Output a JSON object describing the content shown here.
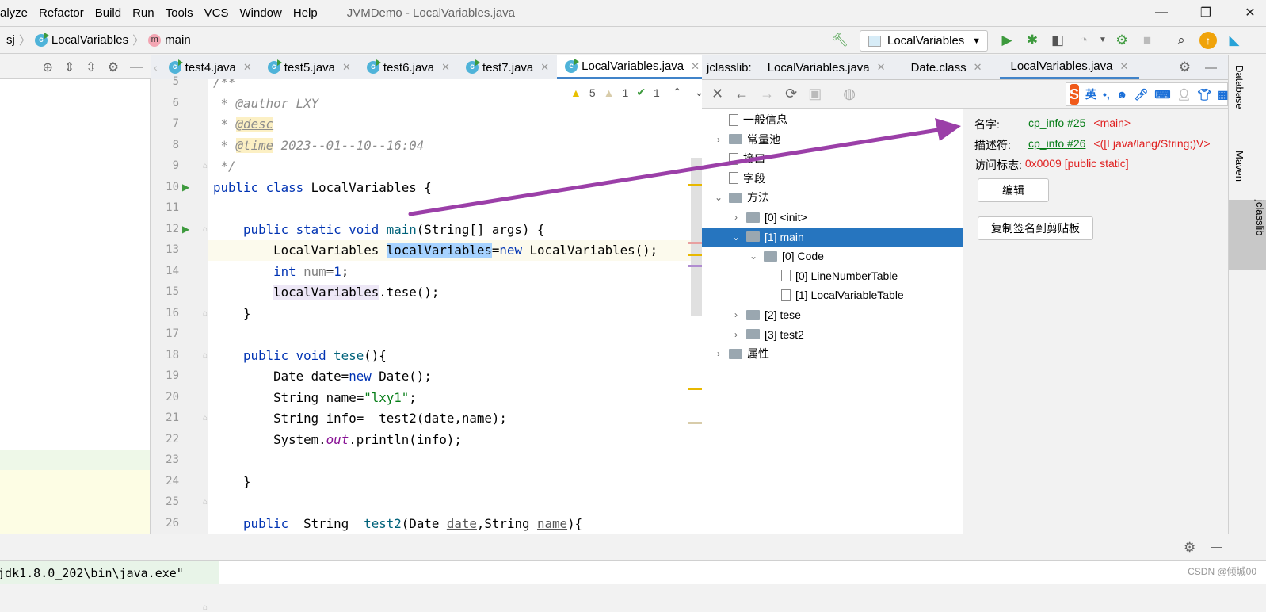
{
  "menu": {
    "items": [
      "alyze",
      "Refactor",
      "Build",
      "Run",
      "Tools",
      "VCS",
      "Window",
      "Help"
    ],
    "title": "JVMDemo - LocalVariables.java"
  },
  "breadcrumb": {
    "items": [
      "sj",
      "LocalVariables",
      "main"
    ]
  },
  "toolbar": {
    "run_config": "LocalVariables"
  },
  "editor": {
    "tabs": [
      {
        "label": "test4.java"
      },
      {
        "label": "test5.java"
      },
      {
        "label": "test6.java"
      },
      {
        "label": "test7.java"
      },
      {
        "label": "LocalVariables.java",
        "active": true
      }
    ],
    "inspections": {
      "warnings": "5",
      "weak_warnings": "1",
      "typos": "1"
    },
    "lines": [
      {
        "n": "5",
        "t": [
          [
            "/**",
            "cm"
          ]
        ]
      },
      {
        "n": "6",
        "t": [
          [
            " * ",
            "cm"
          ],
          [
            "@author",
            "tag"
          ],
          [
            " LXY",
            "cm"
          ]
        ]
      },
      {
        "n": "7",
        "t": [
          [
            " * ",
            "cm"
          ],
          [
            "@desc",
            "tagbg"
          ]
        ]
      },
      {
        "n": "8",
        "t": [
          [
            " * ",
            "cm"
          ],
          [
            "@time",
            "tagbg"
          ],
          [
            " 2023--01--10--16:04",
            "cm"
          ]
        ]
      },
      {
        "n": "9",
        "t": [
          [
            " */",
            "cm"
          ]
        ]
      },
      {
        "n": "10",
        "run": true,
        "t": [
          [
            "public class ",
            "kw"
          ],
          [
            "LocalVariables {",
            ""
          ]
        ]
      },
      {
        "n": "11",
        "t": []
      },
      {
        "n": "12",
        "run": true,
        "t": [
          [
            "    public static void ",
            "kw"
          ],
          [
            "main",
            "fn"
          ],
          [
            "(String[] args) {",
            ""
          ]
        ]
      },
      {
        "n": "13",
        "current": true,
        "t": [
          [
            "        LocalVariables ",
            ""
          ],
          [
            "localVariables",
            "sel"
          ],
          [
            "=",
            ""
          ],
          [
            "new ",
            "kw"
          ],
          [
            "LocalVariables();",
            ""
          ]
        ]
      },
      {
        "n": "14",
        "t": [
          [
            "        ",
            ""
          ],
          [
            "int ",
            "kw"
          ],
          [
            "num",
            "unused"
          ],
          [
            "=",
            ""
          ],
          [
            "1",
            "kw"
          ],
          [
            ";",
            ""
          ]
        ]
      },
      {
        "n": "15",
        "t": [
          [
            "        ",
            ""
          ],
          [
            "localVariables",
            "ref"
          ],
          [
            ".tese();",
            ""
          ]
        ]
      },
      {
        "n": "16",
        "t": [
          [
            "    }",
            ""
          ]
        ]
      },
      {
        "n": "17",
        "t": []
      },
      {
        "n": "18",
        "t": [
          [
            "    public void ",
            "kw"
          ],
          [
            "tese",
            "fn"
          ],
          [
            "(){",
            ""
          ]
        ]
      },
      {
        "n": "19",
        "t": [
          [
            "        Date date=",
            ""
          ],
          [
            "new ",
            "kw"
          ],
          [
            "Date();",
            ""
          ]
        ]
      },
      {
        "n": "20",
        "t": [
          [
            "        String name=",
            ""
          ],
          [
            "\"lxy1\"",
            "str"
          ],
          [
            ";",
            ""
          ]
        ]
      },
      {
        "n": "21",
        "t": [
          [
            "        String info=  test2(date,name);",
            ""
          ]
        ]
      },
      {
        "n": "22",
        "t": [
          [
            "        System.",
            ""
          ],
          [
            "out",
            "st"
          ],
          [
            ".println(info);",
            ""
          ]
        ]
      },
      {
        "n": "23",
        "t": []
      },
      {
        "n": "24",
        "t": [
          [
            "    }",
            ""
          ]
        ]
      },
      {
        "n": "25",
        "t": []
      },
      {
        "n": "26",
        "t": [
          [
            "    public  ",
            "kw"
          ],
          [
            "String  ",
            ""
          ],
          [
            "test2",
            "fn"
          ],
          [
            "(Date ",
            ""
          ],
          [
            "date",
            "par"
          ],
          [
            ",String ",
            ""
          ],
          [
            "name",
            "par"
          ],
          [
            "){",
            ""
          ]
        ]
      }
    ]
  },
  "jclasslib": {
    "prefix": "jclasslib:",
    "tabs": [
      {
        "label": "LocalVariables.java"
      },
      {
        "label": "Date.class"
      },
      {
        "label": "LocalVariables.java",
        "active": true
      }
    ],
    "ime": {
      "lang": "英",
      "punct": "•,"
    },
    "tree": [
      {
        "label": "一般信息",
        "type": "file",
        "depth": 0
      },
      {
        "label": "常量池",
        "type": "folder",
        "depth": 0,
        "chev": ">"
      },
      {
        "label": "接口",
        "type": "file",
        "depth": 0
      },
      {
        "label": "字段",
        "type": "file",
        "depth": 0
      },
      {
        "label": "方法",
        "type": "folder",
        "depth": 0,
        "chev": "v"
      },
      {
        "label": "[0] <init>",
        "type": "folder",
        "depth": 1,
        "chev": ">"
      },
      {
        "label": "[1] main",
        "type": "folder",
        "depth": 1,
        "chev": "v",
        "selected": true
      },
      {
        "label": "[0] Code",
        "type": "folder",
        "depth": 2,
        "chev": "v"
      },
      {
        "label": "[0] LineNumberTable",
        "type": "file",
        "depth": 3
      },
      {
        "label": "[1] LocalVariableTable",
        "type": "file",
        "depth": 3
      },
      {
        "label": "[2] tese",
        "type": "folder",
        "depth": 1,
        "chev": ">"
      },
      {
        "label": "[3] test2",
        "type": "folder",
        "depth": 1,
        "chev": ">"
      },
      {
        "label": "属性",
        "type": "folder",
        "depth": 0,
        "chev": ">"
      }
    ],
    "detail": {
      "name_label": "名字:",
      "name_link": "cp_info #25",
      "name_value": "<main>",
      "desc_label": "描述符:",
      "desc_link": "cp_info #26",
      "desc_value": "<([Ljava/lang/String;)V>",
      "access_label": "访问标志:",
      "access_value": "0x0009 [public static]",
      "edit_button": "编辑",
      "copy_button": "复制签名到剪贴板"
    }
  },
  "right_stripe": [
    "Database",
    "Maven",
    "jclasslib"
  ],
  "console": {
    "text": "\\jdk1.8.0_202\\bin\\java.exe\""
  },
  "watermark": "CSDN @倾城00",
  "colors": {
    "accent": "#2675bf",
    "annotation_arrow": "#9b3fa8",
    "link": "#067d17",
    "value": "#e02020"
  }
}
